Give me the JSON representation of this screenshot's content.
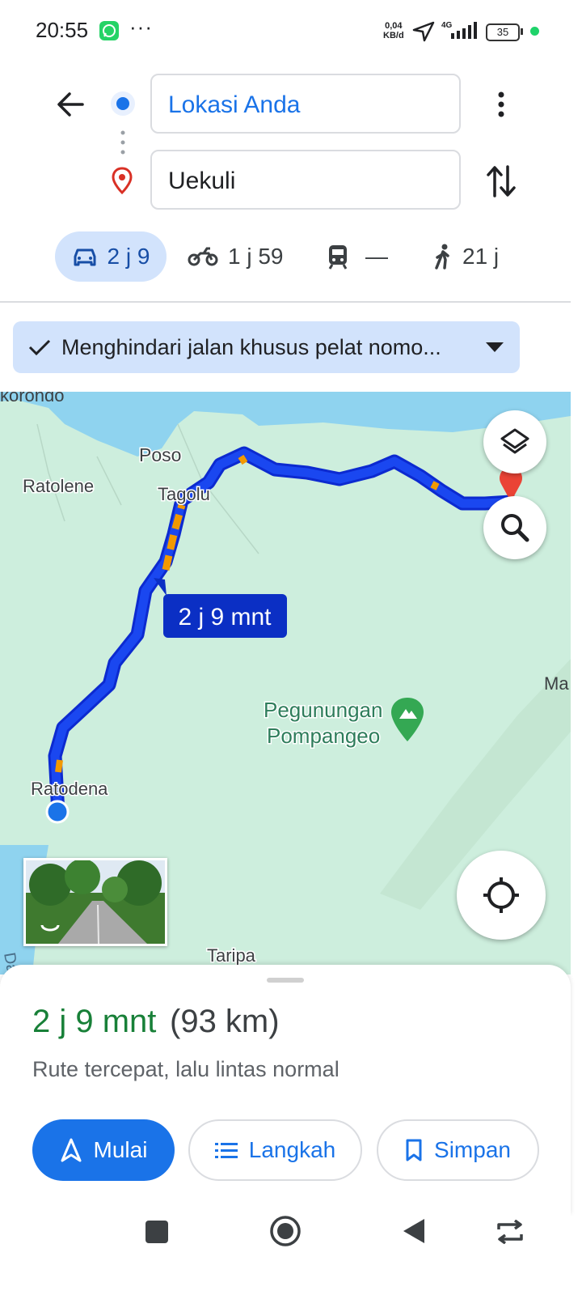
{
  "status": {
    "time": "20:55",
    "net_speed_value": "0,04",
    "net_speed_unit": "KB/d",
    "network": "4G",
    "battery": "35"
  },
  "route": {
    "origin_value": "Lokasi Anda",
    "destination_value": "Uekuli"
  },
  "modes": {
    "car": "2 j 9",
    "motorbike": "1 j 59",
    "transit": "—",
    "walk": "21 j"
  },
  "chip": {
    "text": "Menghindari jalan khusus pelat nomo..."
  },
  "map": {
    "labels": {
      "korondo": "korondo",
      "poso": "Poso",
      "ratolene": "Ratolene",
      "tagolu": "Tagolu",
      "pegunungan_1": "Pegunungan",
      "pegunungan_2": "Pompangeo",
      "ratodena": "Ratodena",
      "taripa": "Taripa",
      "ma": "Ma",
      "dar": "Dar"
    },
    "route_time": "2 j 9 mnt"
  },
  "summary": {
    "duration": "2 j 9 mnt",
    "distance": "(93 km)",
    "description": "Rute tercepat, lalu lintas normal"
  },
  "buttons": {
    "start": "Mulai",
    "steps": "Langkah",
    "save": "Simpan"
  },
  "colors": {
    "route": "#1a47f0",
    "traffic": "#f29900",
    "accent": "#1a73e8",
    "duration_green": "#188038",
    "map_land": "#cdeedd",
    "map_water": "#8fd3ef"
  }
}
